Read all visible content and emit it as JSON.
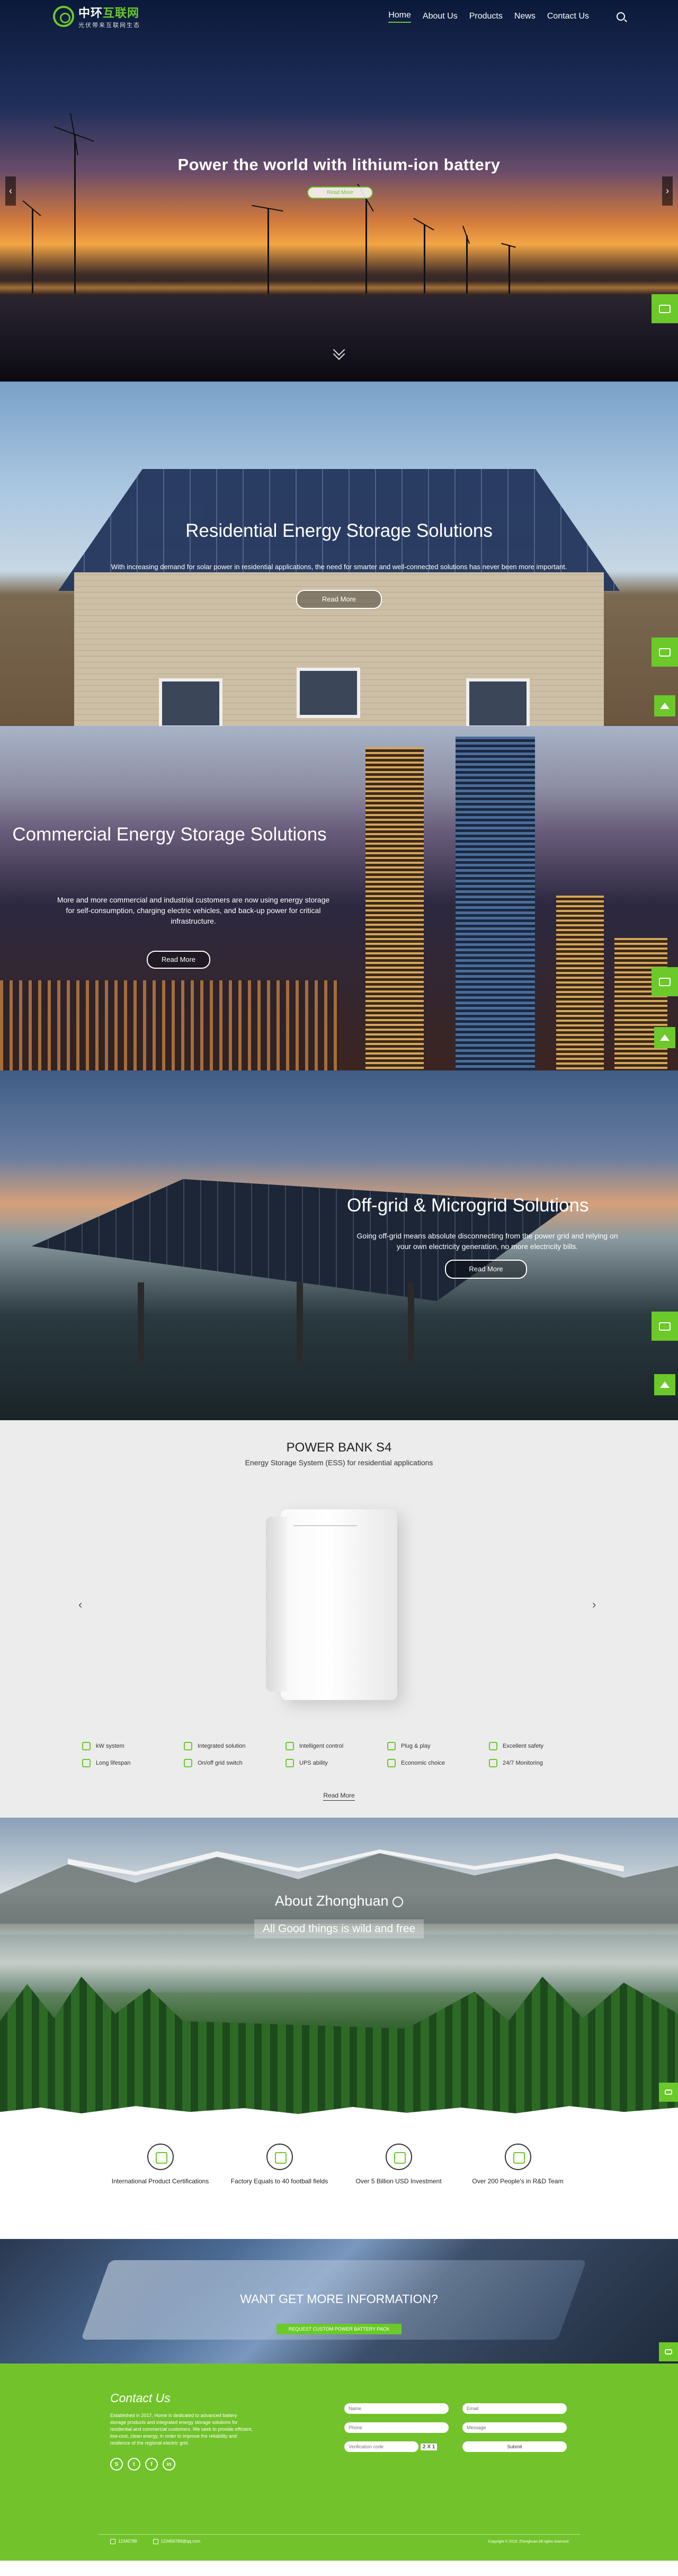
{
  "header": {
    "logo_cn_a": "中环",
    "logo_cn_b": "互联网",
    "logo_sub": "光伏带来互联网生态",
    "nav": [
      "Home",
      "About Us",
      "Products",
      "News",
      "Contact Us"
    ]
  },
  "hero": {
    "title": "Power the world with lithium-ion battery",
    "button": "Read More",
    "prev": "‹",
    "next": "›"
  },
  "residential": {
    "title": "Residential Energy Storage Solutions",
    "text": "With increasing demand for solar power in residential applications, the need for smarter and well-connected solutions has never been more important.",
    "button": "Read More"
  },
  "commercial": {
    "title": "Commercial Energy Storage Solutions",
    "text": "More and more commercial and industrial customers are now using energy storage for self-consumption, charging electric vehicles, and back-up power for critical infrastructure.",
    "button": "Read More"
  },
  "offgrid": {
    "title": "Off-grid & Microgrid Solutions",
    "text": "Going off-grid means absolute disconnecting from the power grid and relying on your own electricity generation, no more electricity bills.",
    "button": "Read More"
  },
  "product": {
    "name": "POWER BANK S4",
    "subtitle": "Energy Storage System (ESS) for residential applications",
    "prev": "‹",
    "next": "›",
    "features": [
      "kW system",
      "Integrated solution",
      "Intelligent control",
      "Plug & play",
      "Excellent safety",
      "Long lifespan",
      "On/off grid switch",
      "UPS ability",
      "Economic choice",
      "24/7 Monitoring"
    ],
    "read_more": "Read More"
  },
  "about": {
    "title": "About Zhonghuan",
    "tagline": "All Good things is wild and free",
    "stats": [
      "International Product Certifications",
      "Factory Equals to 40 football fields",
      "Over 5 Billion USD Investment",
      "Over 200 People's in R&D Team"
    ]
  },
  "cta": {
    "title": "WANT GET MORE INFORMATION?",
    "button": "REQUEST CUSTOM POWER BATTERY PACK"
  },
  "contact": {
    "title": "Contact Us",
    "description": "Established in 2017, Home is dedicated to advanced battery storage products and integrated energy storage solutions for residential and commercial customers. We seek to provide efficient, low-cost, clean energy, in order to improve the reliability and resilience of the regional electric grid.",
    "social": [
      "S",
      "t",
      "f",
      "in"
    ],
    "form": {
      "name_ph": "Name",
      "email_ph": "Email",
      "phone_ph": "Phone",
      "message_ph": "Message",
      "captcha_ph": "Verification code",
      "captcha_code": "2 X 1",
      "submit": "Submit"
    },
    "phone": "12345789",
    "email": "123456789@qq.com",
    "copyright": "Copyright © 2019. Zhonghuan All rights reserved."
  },
  "colors": {
    "accent": "#6bc92a",
    "contact_bg": "#72c32b"
  }
}
